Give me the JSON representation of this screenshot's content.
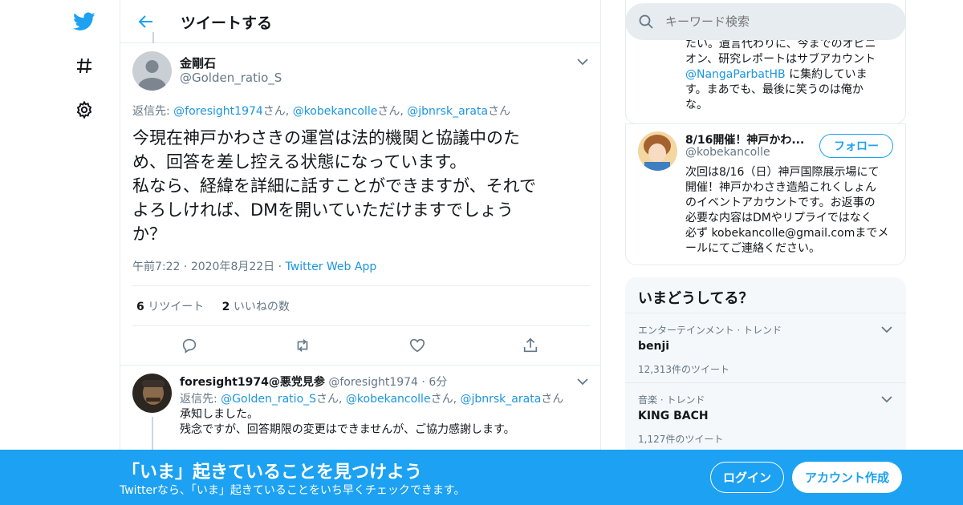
{
  "header": {
    "title": "ツイートする"
  },
  "tweet": {
    "name": "金剛石",
    "handle": "@Golden_ratio_S",
    "reply_prefix": "返信先: ",
    "mentions": [
      "@foresight1974",
      "@kobekancolle",
      "@jbnrsk_arata"
    ],
    "mention_suffix": "さん",
    "sep": ", ",
    "body_lines": [
      "今現在神戸かわさきの運営は法的機関と協議中のた",
      "め、回答を差し控える状態になっています。",
      "私なら、経緯を詳細に話すことができますが、それで",
      "よろしければ、DMを開いていただけますでしょう",
      "か？"
    ],
    "time": "午前7:22",
    "date": "2020年8月22日",
    "dot": "·",
    "source": "Twitter Web App",
    "retweets_count": "6",
    "retweets_label": "リツイート",
    "likes_count": "2",
    "likes_label": "いいねの数"
  },
  "reply": {
    "name": "foresight1974@悪党見参",
    "handle": "@foresight1974",
    "dot": "·",
    "time": "6分",
    "reply_prefix": "返信先: ",
    "mentions": [
      "@Golden_ratio_S",
      "@kobekancolle",
      "@jbnrsk_arata"
    ],
    "mention_suffix": "さん",
    "sep": ", ",
    "line1": "承知しました。",
    "line2": "残念ですが、回答期限の変更はできませんが、ご協力感謝します。"
  },
  "search": {
    "placeholder": "キーワード検索"
  },
  "profile_top": {
    "lines": [
      "たい。遺言代わりに、今までのオピニ",
      "オン、研究レポートはサブアカウント"
    ],
    "link": "@NangaParbatHB",
    "after_link": " に集約していま",
    "lines2": [
      "す。まあでも、最後に笑うのは俺か",
      "な。"
    ]
  },
  "profile_card": {
    "name": "8/16開催！神戸かわ...",
    "handle": "@kobekancolle",
    "follow_label": "フォロー",
    "bio_lines": [
      "次回は8/16（日）神戸国際展示場にて",
      "開催！神戸かわさき造船これくしょん",
      "のイベントアカウントです。お返事の",
      "必要な内容はDMやリプライではなく",
      "必ず kobekancolle@gmail.comまでメ",
      "ールにてご連絡ください。"
    ]
  },
  "trends": {
    "title": "いまどうしてる？",
    "items": [
      {
        "category": "エンターテインメント · トレンド",
        "name": "benji",
        "count": "12,313件のツイート"
      },
      {
        "category": "音楽 · トレンド",
        "name": "KING BACH",
        "count": "1,127件のツイート"
      }
    ]
  },
  "banner": {
    "headline": "「いま」起きていることを見つけよう",
    "sub": "Twitterなら、「いま」起きていることをいち早くチェックできます。",
    "login_label": "ログイン",
    "signup_label": "アカウント作成"
  },
  "colors": {
    "accent": "#1da1f2",
    "link": "#1b95e0",
    "muted": "#657786"
  }
}
